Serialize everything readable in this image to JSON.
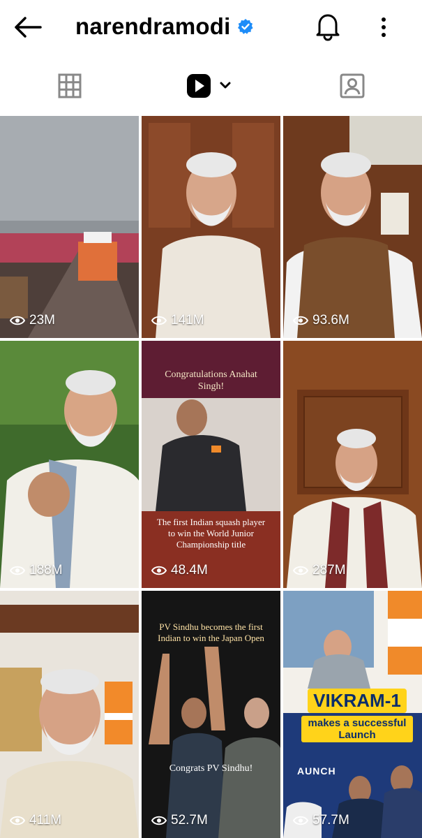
{
  "header": {
    "username": "narendramodi",
    "icons": {
      "back": "back-arrow-icon",
      "verified": "verified-badge-icon",
      "notifications": "bell-icon",
      "more": "more-vertical-icon"
    }
  },
  "tabs": {
    "items": [
      {
        "name": "grid",
        "icon": "grid-icon"
      },
      {
        "name": "reels",
        "icon": "reels-icon",
        "active": true
      },
      {
        "name": "tagged",
        "icon": "tagged-icon"
      }
    ]
  },
  "reels": [
    {
      "views": "23M"
    },
    {
      "views": "141M"
    },
    {
      "views": "93.6M"
    },
    {
      "views": "188M"
    },
    {
      "views": "48.4M",
      "caption_top": "Congratulations Anahat Singh!",
      "caption_bottom": "The first Indian squash player to win the World Junior Championship title"
    },
    {
      "views": "287M"
    },
    {
      "views": "411M"
    },
    {
      "views": "52.7M",
      "caption_top": "PV Sindhu becomes the first Indian to win the Japan Open",
      "caption_bottom": "Congrats PV Sindhu!"
    },
    {
      "views": "57.7M",
      "headline": "VIKRAM-1",
      "subline": "makes a successful Launch",
      "banner_text": "AUNCH"
    }
  ],
  "colors": {
    "background": "#ffffff",
    "text": "#000000",
    "verified": "#1d8cf8"
  }
}
